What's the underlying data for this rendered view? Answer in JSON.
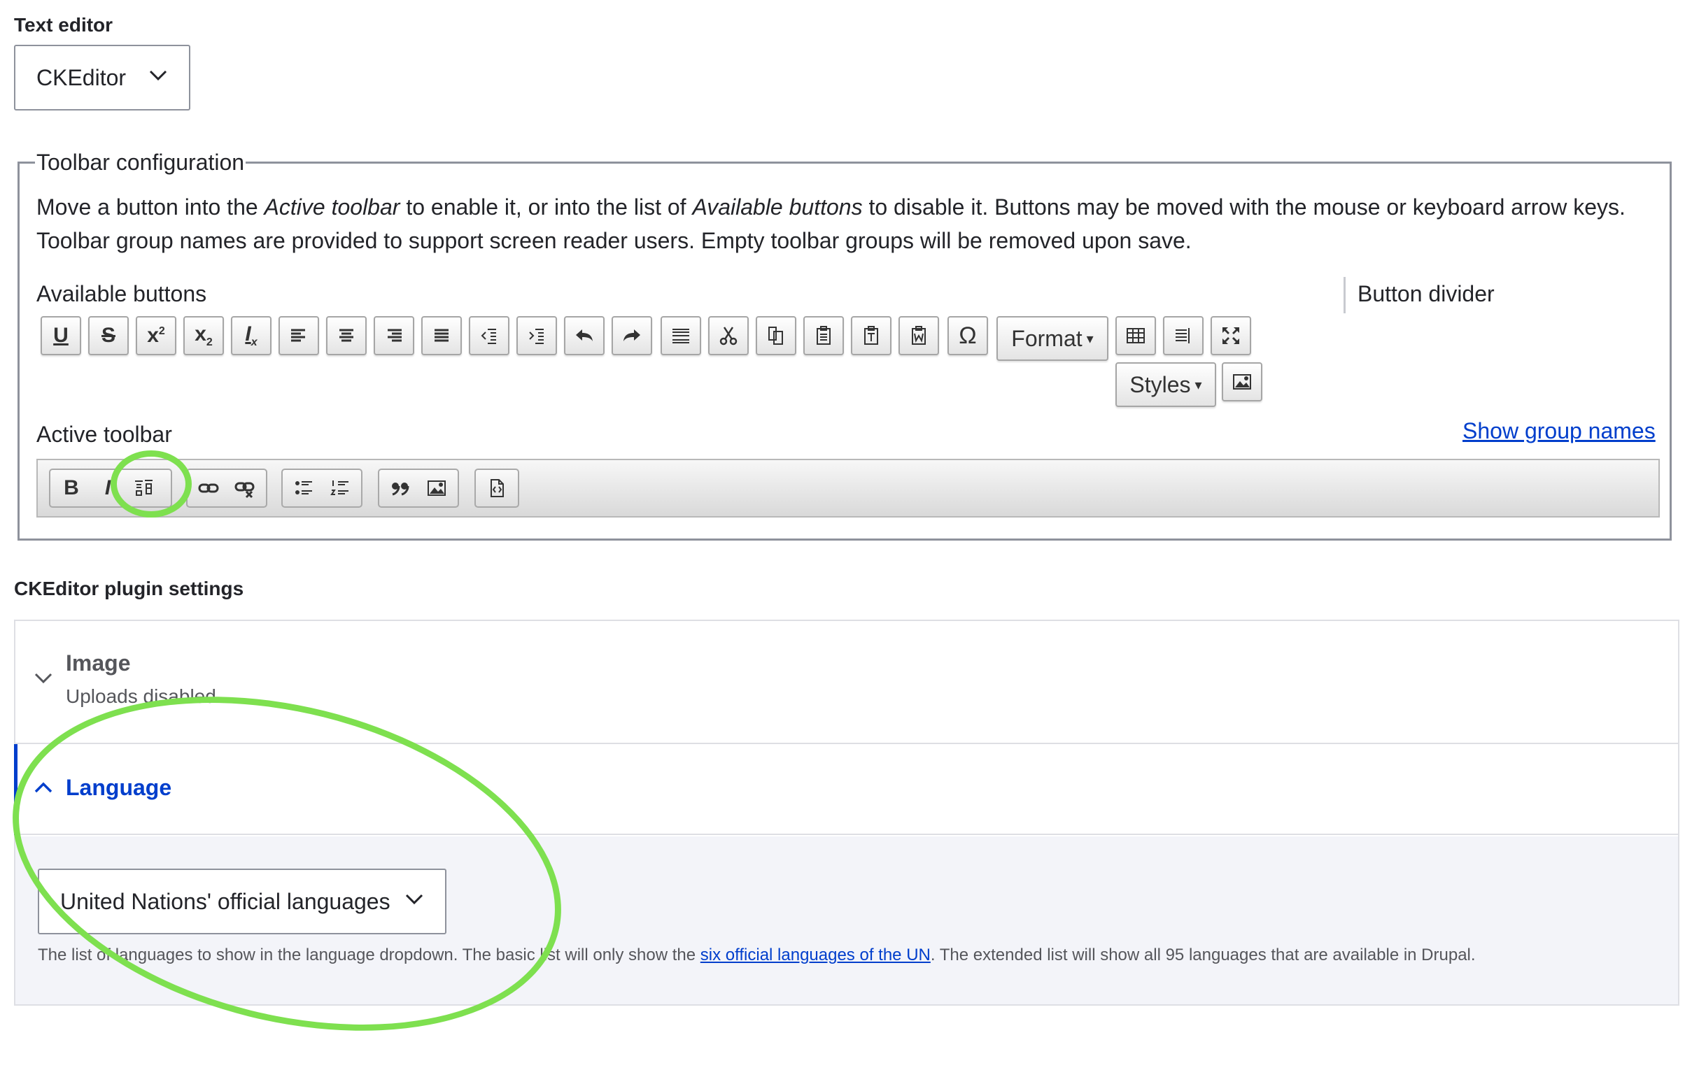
{
  "text_editor": {
    "label": "Text editor",
    "selected": "CKEditor"
  },
  "toolbar_config": {
    "legend": "Toolbar configuration",
    "desc_1": "Move a button into the ",
    "desc_em_1": "Active toolbar",
    "desc_2": " to enable it, or into the list of ",
    "desc_em_2": "Available buttons",
    "desc_3": " to disable it. Buttons may be moved with the mouse or keyboard arrow keys. Toolbar group names are provided to support screen reader users. Empty toolbar groups will be removed upon save.",
    "available_label": "Available buttons",
    "divider_label": "Button divider",
    "format_label": "Format",
    "styles_label": "Styles",
    "active_label": "Active toolbar",
    "show_group_names": "Show group names",
    "available_buttons": [
      "underline-icon",
      "strikethrough-icon",
      "superscript-icon",
      "subscript-icon",
      "remove-format-icon",
      "align-left-icon",
      "align-center-icon",
      "align-right-icon",
      "justify-icon",
      "outdent-icon",
      "indent-icon",
      "undo-icon",
      "redo-icon",
      "horizontal-line-icon",
      "cut-icon",
      "copy-icon",
      "paste-icon",
      "paste-text-icon",
      "paste-word-icon",
      "special-char-icon",
      "format-dropdown",
      "table-icon",
      "show-blocks-icon",
      "maximize-icon",
      "styles-dropdown",
      "image-icon"
    ],
    "active_groups": [
      [
        "bold-icon",
        "italic-icon",
        "language-icon"
      ],
      [
        "link-icon",
        "unlink-icon"
      ],
      [
        "bulleted-list-icon",
        "numbered-list-icon"
      ],
      [
        "blockquote-icon",
        "image-icon"
      ],
      [
        "source-icon"
      ]
    ]
  },
  "plugin_settings": {
    "label": "CKEditor plugin settings",
    "image": {
      "title": "Image",
      "subtitle": "Uploads disabled"
    },
    "language": {
      "title": "Language",
      "selected": "United Nations' official languages",
      "desc_1": "The list of languages to show in the language dropdown. The basic list will only show the ",
      "desc_link": "six official languages of the UN",
      "desc_2": ". The extended list will show all 95 languages that are available in Drupal."
    }
  },
  "colors": {
    "link": "#003ecc",
    "highlight": "#7ee04f",
    "panel_bg": "#f3f4f9"
  }
}
